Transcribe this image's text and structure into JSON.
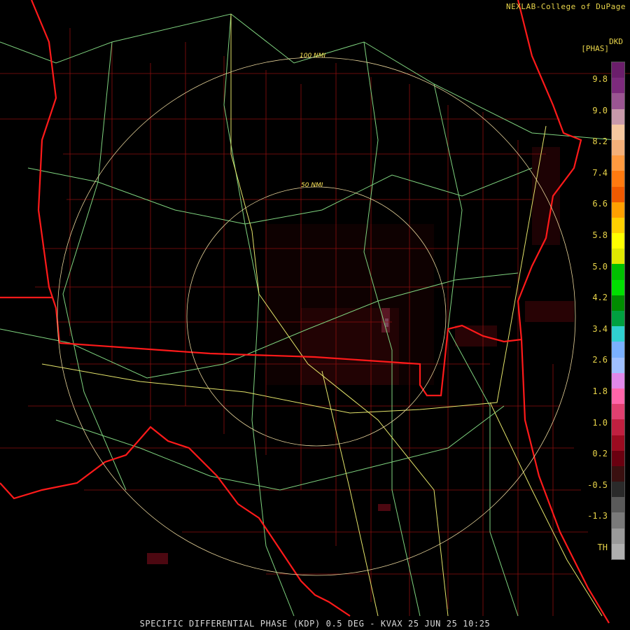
{
  "credit": "NEXLAB-College of DuPage",
  "units_line1": "DKD",
  "units_line2": "[PHAS]",
  "legend": {
    "ticks": [
      "9.8",
      "9.0",
      "8.2",
      "7.4",
      "6.6",
      "5.8",
      "5.0",
      "4.2",
      "3.4",
      "2.6",
      "1.8",
      "1.0",
      "0.2",
      "-0.5",
      "-1.3",
      "TH"
    ],
    "colors": [
      "#6b1e6b",
      "#7c2a7c",
      "#9a5592",
      "#c89aab",
      "#f5c8a0",
      "#f4b07a",
      "#ff9a40",
      "#ff7a10",
      "#f05a00",
      "#ffa000",
      "#ffd000",
      "#ffff00",
      "#e0e800",
      "#00c000",
      "#00e000",
      "#008c00",
      "#00a040",
      "#30d0d0",
      "#7ab0ff",
      "#a0c0ff",
      "#e088e8",
      "#ff66aa",
      "#e04070",
      "#c02040",
      "#9b0b20",
      "#6a0010",
      "#3a1010",
      "#2a2a2a",
      "#5a5a5a",
      "#7a7a7a",
      "#9a9a9a",
      "#b0b0b0"
    ]
  },
  "rings": [
    {
      "label": "100 NMI"
    },
    {
      "label": "50 NMI"
    }
  ],
  "footer": "SPECIFIC DIFFERENTIAL PHASE (KDP) 0.5 DEG - KVAX 25 JUN 25 10:25"
}
